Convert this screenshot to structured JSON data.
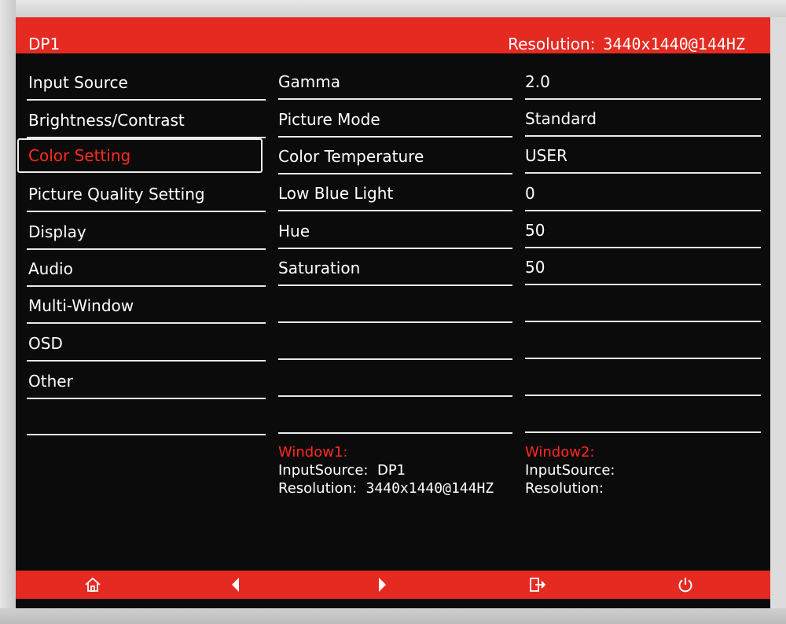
{
  "header": {
    "source": "DP1",
    "resolution_label": "Resolution:",
    "resolution_value": "3440x1440@144HZ"
  },
  "menu": {
    "items": [
      {
        "label": "Input Source"
      },
      {
        "label": "Brightness/Contrast"
      },
      {
        "label": "Color Setting"
      },
      {
        "label": "Picture Quality Setting"
      },
      {
        "label": "Display"
      },
      {
        "label": "Audio"
      },
      {
        "label": "Multi-Window"
      },
      {
        "label": "OSD"
      },
      {
        "label": "Other"
      },
      {
        "label": ""
      }
    ],
    "selected_index": 2,
    "selected_color": "#ff2a20"
  },
  "settings": {
    "rows": [
      {
        "name": "Gamma",
        "value": "2.0"
      },
      {
        "name": "Picture Mode",
        "value": "Standard"
      },
      {
        "name": "Color Temperature",
        "value": "USER"
      },
      {
        "name": "Low Blue Light",
        "value": "0"
      },
      {
        "name": "Hue",
        "value": "50"
      },
      {
        "name": "Saturation",
        "value": "50"
      },
      {
        "name": "",
        "value": ""
      },
      {
        "name": "",
        "value": ""
      },
      {
        "name": "",
        "value": ""
      },
      {
        "name": "",
        "value": ""
      }
    ]
  },
  "windows": {
    "window1": {
      "title": "Window1:",
      "input_label": "InputSource:",
      "input_value": "DP1",
      "resolution_label": "Resolution:",
      "resolution_value": "3440x1440@144HZ"
    },
    "window2": {
      "title": "Window2:",
      "input_label": "InputSource:",
      "input_value": "",
      "resolution_label": "Resolution:",
      "resolution_value": ""
    }
  },
  "footer": {
    "buttons": [
      {
        "icon": "home-icon"
      },
      {
        "icon": "arrow-left-icon"
      },
      {
        "icon": "arrow-right-icon"
      },
      {
        "icon": "exit-icon"
      },
      {
        "icon": "power-icon"
      }
    ]
  },
  "colors": {
    "accent_red": "#e52a22",
    "background": "#0b0b0b",
    "text": "#ffffff"
  }
}
